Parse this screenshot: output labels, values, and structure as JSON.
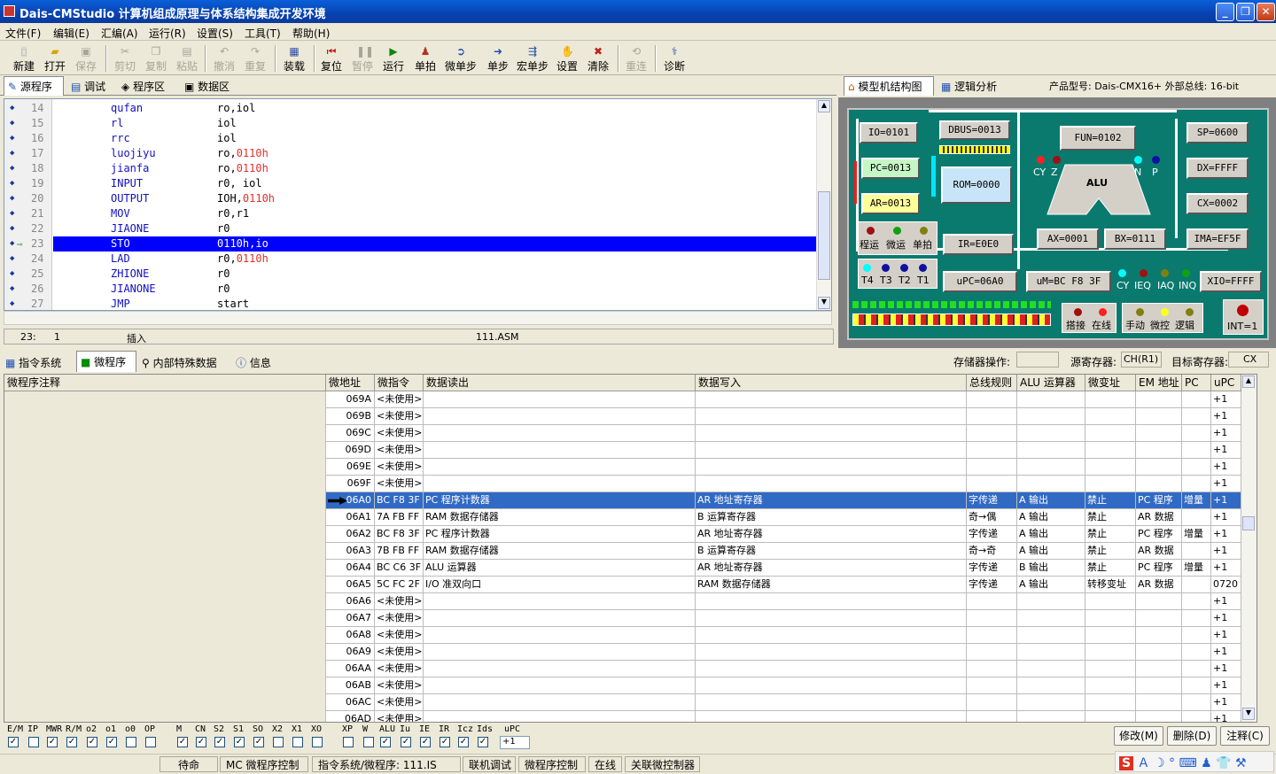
{
  "app": {
    "title": "Dais-CMStudio 计算机组成原理与体系结构集成开发环境"
  },
  "window": {
    "minimize": "_",
    "maximize": "❐",
    "close": "✕"
  },
  "menu": [
    "文件(F)",
    "编辑(E)",
    "汇编(A)",
    "运行(R)",
    "设置(S)",
    "工具(T)",
    "帮助(H)"
  ],
  "toolbar": [
    {
      "label": "新建",
      "icon": "new-icon",
      "enabled": true
    },
    {
      "label": "打开",
      "icon": "open-icon",
      "enabled": true
    },
    {
      "label": "保存",
      "icon": "save-icon",
      "enabled": false
    },
    {
      "label": "剪切",
      "icon": "cut-icon",
      "enabled": false
    },
    {
      "label": "复制",
      "icon": "copy-icon",
      "enabled": false
    },
    {
      "label": "粘贴",
      "icon": "paste-icon",
      "enabled": false
    },
    {
      "label": "撤消",
      "icon": "undo-icon",
      "enabled": false
    },
    {
      "label": "重复",
      "icon": "redo-icon",
      "enabled": false
    },
    {
      "label": "装载",
      "icon": "load-icon",
      "enabled": true
    },
    {
      "label": "复位",
      "icon": "reset-icon",
      "enabled": true
    },
    {
      "label": "暂停",
      "icon": "pause-icon",
      "enabled": false
    },
    {
      "label": "运行",
      "icon": "run-icon",
      "enabled": true
    },
    {
      "label": "单拍",
      "icon": "single-beat-icon",
      "enabled": true
    },
    {
      "label": "微单步",
      "icon": "micro-step-icon",
      "enabled": true
    },
    {
      "label": "单步",
      "icon": "step-icon",
      "enabled": true
    },
    {
      "label": "宏单步",
      "icon": "macro-step-icon",
      "enabled": true
    },
    {
      "label": "设置",
      "icon": "settings-icon",
      "enabled": true
    },
    {
      "label": "清除",
      "icon": "clear-icon",
      "enabled": true
    },
    {
      "label": "重连",
      "icon": "reconnect-icon",
      "enabled": false
    },
    {
      "label": "诊断",
      "icon": "diagnose-icon",
      "enabled": true
    }
  ],
  "editor_tabs": [
    "源程序",
    "调试",
    "程序区",
    "数据区"
  ],
  "source_lines": [
    {
      "n": "14",
      "op": "qufan",
      "arg": "ro,iol",
      "hex": ""
    },
    {
      "n": "15",
      "op": "rl",
      "arg": "iol",
      "hex": ""
    },
    {
      "n": "16",
      "op": "rrc",
      "arg": "iol",
      "hex": ""
    },
    {
      "n": "17",
      "op": "luojiyu",
      "arg": "ro,",
      "hex": "0110h"
    },
    {
      "n": "18",
      "op": "jianfa",
      "arg": "ro,",
      "hex": "0110h"
    },
    {
      "n": "19",
      "op": "INPUT",
      "arg": "r0, iol",
      "hex": ""
    },
    {
      "n": "20",
      "op": "OUTPUT",
      "arg": "IOH,",
      "hex": "0110h"
    },
    {
      "n": "21",
      "op": "MOV",
      "arg": "r0,r1",
      "hex": ""
    },
    {
      "n": "22",
      "op": "JIAONE",
      "arg": "r0",
      "hex": ""
    },
    {
      "n": "23",
      "op": "STO",
      "arg": "0110h,io",
      "hex": ""
    },
    {
      "n": "24",
      "op": "LAD",
      "arg": "r0,",
      "hex": "0110h"
    },
    {
      "n": "25",
      "op": "ZHIONE",
      "arg": "r0",
      "hex": ""
    },
    {
      "n": "26",
      "op": "JIANONE",
      "arg": "r0",
      "hex": ""
    },
    {
      "n": "27",
      "op": "JMP",
      "arg": "start",
      "hex": ""
    }
  ],
  "editor_status": {
    "line": "23:",
    "col": "1",
    "mode": "插入",
    "file": "111.ASM"
  },
  "right_tabs": {
    "model": "模型机结构图",
    "logic": "逻辑分析",
    "product": "产品型号: Dais-CMX16+  外部总线: 16-bit"
  },
  "machine": {
    "io": "IO=0101",
    "dbus": "DBUS=0013",
    "fun": "FUN=0102",
    "sp": "SP=0600",
    "pc": "PC=0013",
    "ar": "AR=0013",
    "rom": "ROM=0000",
    "dx": "DX=FFFF",
    "cx": "CX=0002",
    "ir": "IR=E0E0",
    "ax": "AX=0001",
    "bx": "BX=0111",
    "ima": "IMA=EF5F",
    "upc": "uPC=06A0",
    "um": "uM=BC  F8  3F",
    "xio": "XIO=FFFF",
    "alu": "ALU",
    "cy": "CY",
    "z": "Z",
    "n": "N",
    "p": "P",
    "mode_leds": [
      "程运",
      "微运",
      "单拍"
    ],
    "t_leds": [
      "T4",
      "T3",
      "T2",
      "T1"
    ],
    "flag_leds": [
      "CY",
      "IEQ",
      "IAQ",
      "INQ"
    ],
    "sw1": [
      "搭接",
      "在线"
    ],
    "sw2": [
      "手动",
      "微控",
      "逻辑"
    ],
    "int": "INT=1"
  },
  "bottom_tabs": [
    "指令系统",
    "微程序",
    "内部特殊数据",
    "信息"
  ],
  "storage": {
    "op_label": "存储器操作:",
    "op_value": "",
    "src_label": "源寄存器:",
    "src_value": "CH(R1)",
    "dst_label": "目标寄存器:",
    "dst_value": "CX"
  },
  "grid_headers": [
    "微程序注释",
    "微地址",
    "微指令",
    "数据读出",
    "数据写入",
    "总线规则",
    "ALU 运算器",
    "微变址",
    "EM 地址",
    "PC",
    "uPC"
  ],
  "grid_rows": [
    {
      "addr": "069A",
      "mi": "<未使用>",
      "rd": "",
      "wr": "",
      "bus": "",
      "alu": "",
      "bx": "",
      "em": "",
      "pc": "",
      "upc": "+1"
    },
    {
      "addr": "069B",
      "mi": "<未使用>",
      "rd": "",
      "wr": "",
      "bus": "",
      "alu": "",
      "bx": "",
      "em": "",
      "pc": "",
      "upc": "+1"
    },
    {
      "addr": "069C",
      "mi": "<未使用>",
      "rd": "",
      "wr": "",
      "bus": "",
      "alu": "",
      "bx": "",
      "em": "",
      "pc": "",
      "upc": "+1"
    },
    {
      "addr": "069D",
      "mi": "<未使用>",
      "rd": "",
      "wr": "",
      "bus": "",
      "alu": "",
      "bx": "",
      "em": "",
      "pc": "",
      "upc": "+1"
    },
    {
      "addr": "069E",
      "mi": "<未使用>",
      "rd": "",
      "wr": "",
      "bus": "",
      "alu": "",
      "bx": "",
      "em": "",
      "pc": "",
      "upc": "+1"
    },
    {
      "addr": "069F",
      "mi": "<未使用>",
      "rd": "",
      "wr": "",
      "bus": "",
      "alu": "",
      "bx": "",
      "em": "",
      "pc": "",
      "upc": "+1"
    },
    {
      "addr": "06A0",
      "mi": "BC F8 3F",
      "rd": "PC 程序计数器",
      "wr": "AR 地址寄存器",
      "bus": "字传递",
      "alu": "A 输出",
      "bx": "禁止",
      "em": "PC 程序",
      "pc": "增量",
      "upc": "+1",
      "sel": true
    },
    {
      "addr": "06A1",
      "mi": "7A FB FF",
      "rd": "RAM 数据存储器",
      "wr": "B 运算寄存器",
      "bus": "奇→偶",
      "alu": "A 输出",
      "bx": "禁止",
      "em": "AR 数据",
      "pc": "",
      "upc": "+1"
    },
    {
      "addr": "06A2",
      "mi": "BC F8 3F",
      "rd": "PC 程序计数器",
      "wr": "AR 地址寄存器",
      "bus": "字传递",
      "alu": "A 输出",
      "bx": "禁止",
      "em": "PC 程序",
      "pc": "增量",
      "upc": "+1"
    },
    {
      "addr": "06A3",
      "mi": "7B FB FF",
      "rd": "RAM 数据存储器",
      "wr": "B 运算寄存器",
      "bus": "奇→奇",
      "alu": "A 输出",
      "bx": "禁止",
      "em": "AR 数据",
      "pc": "",
      "upc": "+1"
    },
    {
      "addr": "06A4",
      "mi": "BC C6 3F",
      "rd": "ALU 运算器",
      "wr": "AR 地址寄存器",
      "bus": "字传递",
      "alu": "B 输出",
      "bx": "禁止",
      "em": "PC 程序",
      "pc": "增量",
      "upc": "+1"
    },
    {
      "addr": "06A5",
      "mi": "5C FC 2F",
      "rd": "I/O 准双向口",
      "wr": "RAM 数据存储器",
      "bus": "字传递",
      "alu": "A 输出",
      "bx": "转移变址",
      "em": "AR 数据",
      "pc": "",
      "upc": "0720"
    },
    {
      "addr": "06A6",
      "mi": "<未使用>",
      "rd": "",
      "wr": "",
      "bus": "",
      "alu": "",
      "bx": "",
      "em": "",
      "pc": "",
      "upc": "+1"
    },
    {
      "addr": "06A7",
      "mi": "<未使用>",
      "rd": "",
      "wr": "",
      "bus": "",
      "alu": "",
      "bx": "",
      "em": "",
      "pc": "",
      "upc": "+1"
    },
    {
      "addr": "06A8",
      "mi": "<未使用>",
      "rd": "",
      "wr": "",
      "bus": "",
      "alu": "",
      "bx": "",
      "em": "",
      "pc": "",
      "upc": "+1"
    },
    {
      "addr": "06A9",
      "mi": "<未使用>",
      "rd": "",
      "wr": "",
      "bus": "",
      "alu": "",
      "bx": "",
      "em": "",
      "pc": "",
      "upc": "+1"
    },
    {
      "addr": "06AA",
      "mi": "<未使用>",
      "rd": "",
      "wr": "",
      "bus": "",
      "alu": "",
      "bx": "",
      "em": "",
      "pc": "",
      "upc": "+1"
    },
    {
      "addr": "06AB",
      "mi": "<未使用>",
      "rd": "",
      "wr": "",
      "bus": "",
      "alu": "",
      "bx": "",
      "em": "",
      "pc": "",
      "upc": "+1"
    },
    {
      "addr": "06AC",
      "mi": "<未使用>",
      "rd": "",
      "wr": "",
      "bus": "",
      "alu": "",
      "bx": "",
      "em": "",
      "pc": "",
      "upc": "+1"
    },
    {
      "addr": "06AD",
      "mi": "<未使用>",
      "rd": "",
      "wr": "",
      "bus": "",
      "alu": "",
      "bx": "",
      "em": "",
      "pc": "",
      "upc": "+1"
    }
  ],
  "bits": [
    {
      "l": "E/M",
      "c": true
    },
    {
      "l": "IP",
      "c": false
    },
    {
      "l": "MWR",
      "c": true
    },
    {
      "l": "R/M",
      "c": true
    },
    {
      "l": "o2",
      "c": true
    },
    {
      "l": "o1",
      "c": true
    },
    {
      "l": "o0",
      "c": false
    },
    {
      "l": "OP",
      "c": false
    },
    {
      "l": "M",
      "c": true
    },
    {
      "l": "CN",
      "c": true
    },
    {
      "l": "S2",
      "c": true
    },
    {
      "l": "S1",
      "c": true
    },
    {
      "l": "SO",
      "c": true
    },
    {
      "l": "X2",
      "c": false
    },
    {
      "l": "X1",
      "c": false
    },
    {
      "l": "XO",
      "c": false
    },
    {
      "l": "XP",
      "c": false
    },
    {
      "l": "W",
      "c": false
    },
    {
      "l": "ALU",
      "c": true
    },
    {
      "l": "Iu",
      "c": true
    },
    {
      "l": "IE",
      "c": true
    },
    {
      "l": "IR",
      "c": true
    },
    {
      "l": "Icz",
      "c": true
    },
    {
      "l": "Ids",
      "c": true
    }
  ],
  "upc_field": {
    "label": "uPC",
    "value": "+1"
  },
  "bottom_buttons": [
    "修改(M)",
    "删除(D)",
    "注释(C)"
  ],
  "status": [
    "待命",
    "MC 微程序控制",
    "指令系统/微程序: 111.IS",
    "联机调试",
    "微程序控制",
    "在线",
    "关联微控制器"
  ],
  "colors": {
    "accent": "#316ac5",
    "selected_line": "#0000ff",
    "board": "#0a7a6f"
  }
}
